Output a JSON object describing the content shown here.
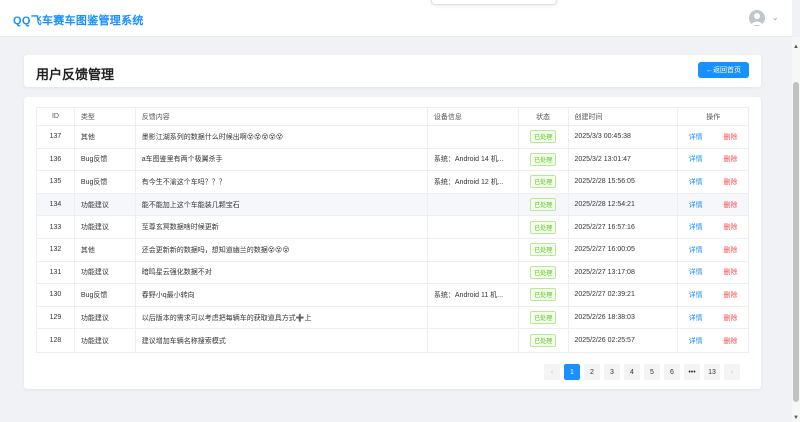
{
  "app": {
    "title": "QQ飞车赛车图鉴管理系统"
  },
  "header": {
    "page_title": "用户反馈管理",
    "back_label": "←返回首页"
  },
  "table": {
    "columns": [
      "ID",
      "类型",
      "反馈内容",
      "设备信息",
      "状态",
      "创建时间",
      "操作"
    ],
    "rows": [
      {
        "id": "137",
        "type": "其他",
        "content": "墨影江湖系列的数据什么时候出啊😵😵😵😵😵",
        "device": "",
        "status": "已处理",
        "time": "2025/3/3 00:45:38"
      },
      {
        "id": "136",
        "type": "Bug反馈",
        "content": "a车图鉴里有两个极翼杀手",
        "device": "系统：Android 14 机...",
        "status": "已处理",
        "time": "2025/3/2 13:01:47"
      },
      {
        "id": "135",
        "type": "Bug反馈",
        "content": "有今生不渝这个车吗？？？",
        "device": "系统：Android 12 机...",
        "status": "已处理",
        "time": "2025/2/28 15:56:05"
      },
      {
        "id": "134",
        "type": "功能建议",
        "content": "能不能加上这个车能装几颗宝石",
        "device": "",
        "status": "已处理",
        "time": "2025/2/28 12:54:21"
      },
      {
        "id": "133",
        "type": "功能建议",
        "content": "至尊玄冥数据啥时候更新",
        "device": "",
        "status": "已处理",
        "time": "2025/2/27 16:57:16"
      },
      {
        "id": "132",
        "type": "其他",
        "content": "还会更新新的数据吗，想知道幽兰的数据😵😵😵",
        "device": "",
        "status": "已处理",
        "time": "2025/2/27 16:00:05"
      },
      {
        "id": "131",
        "type": "功能建议",
        "content": "暗鸣星云强化数据不对",
        "device": "",
        "status": "已处理",
        "time": "2025/2/27 13:17:08"
      },
      {
        "id": "130",
        "type": "Bug反馈",
        "content": "春野小q最小转向",
        "device": "系统：Android 11 机...",
        "status": "已处理",
        "time": "2025/2/27 02:39:21"
      },
      {
        "id": "129",
        "type": "功能建议",
        "content": "以后版本的需求可以考虑把每辆车的获取道具方式➕上",
        "device": "",
        "status": "已处理",
        "time": "2025/2/26 18:38:03"
      },
      {
        "id": "128",
        "type": "功能建议",
        "content": "建议增加车辆名称搜索模式",
        "device": "",
        "status": "已处理",
        "time": "2025/2/26 02:25:57"
      }
    ],
    "op_detail": "详情",
    "op_delete": "删除"
  },
  "pagination": {
    "prev": "‹",
    "next": "›",
    "pages": [
      "1",
      "2",
      "3",
      "4",
      "5",
      "6",
      "•••",
      "13"
    ],
    "current": "1"
  },
  "colors": {
    "primary": "#1890ff",
    "danger": "#ff4d4f",
    "success": "#52c41a"
  }
}
